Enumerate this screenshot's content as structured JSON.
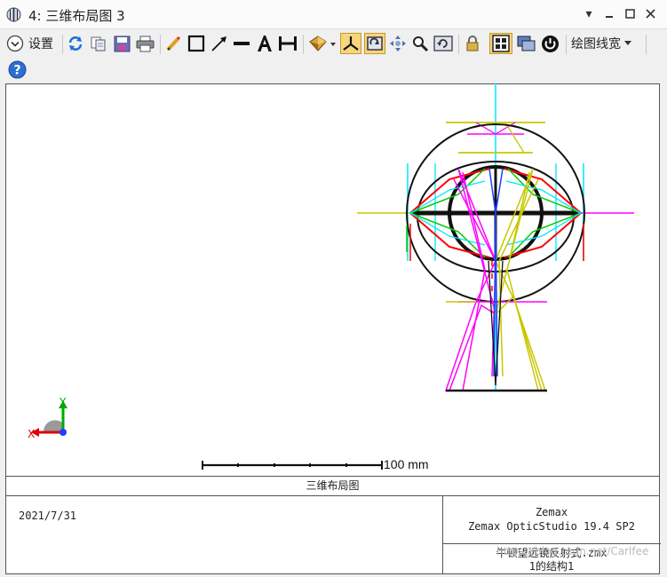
{
  "window": {
    "title": "4: 三维布局图 3",
    "controls": [
      "dropdown-arrow",
      "minimize",
      "maximize",
      "close"
    ]
  },
  "toolbar": {
    "settings_label": "设置",
    "line_width_label": "绘图线宽",
    "icons": [
      "refresh-icon",
      "copy-icon",
      "save-icon",
      "print-icon",
      "pencil-icon",
      "rectangle-icon",
      "arrow-line-icon",
      "line-icon",
      "text-icon",
      "dimension-icon",
      "rotate-view-icon",
      "axes-icon",
      "fit-icon",
      "pan-icon",
      "zoom-icon",
      "reset-icon",
      "lock-icon",
      "grid-icon",
      "layers-icon",
      "power-icon"
    ]
  },
  "help": {
    "icon": "help-icon"
  },
  "plot": {
    "scale_label": "100 mm",
    "axis_x_label": "X",
    "axis_y_label": "Y"
  },
  "footer": {
    "title": "三维布局图",
    "date": "2021/7/31",
    "company": "Zemax",
    "software": "Zemax OpticStudio 19.4 SP2",
    "filename": "牛顿望远镜反射式.zmx",
    "config": "1的结构1",
    "watermark": "https://blog.csdn.net/Carlfee"
  }
}
